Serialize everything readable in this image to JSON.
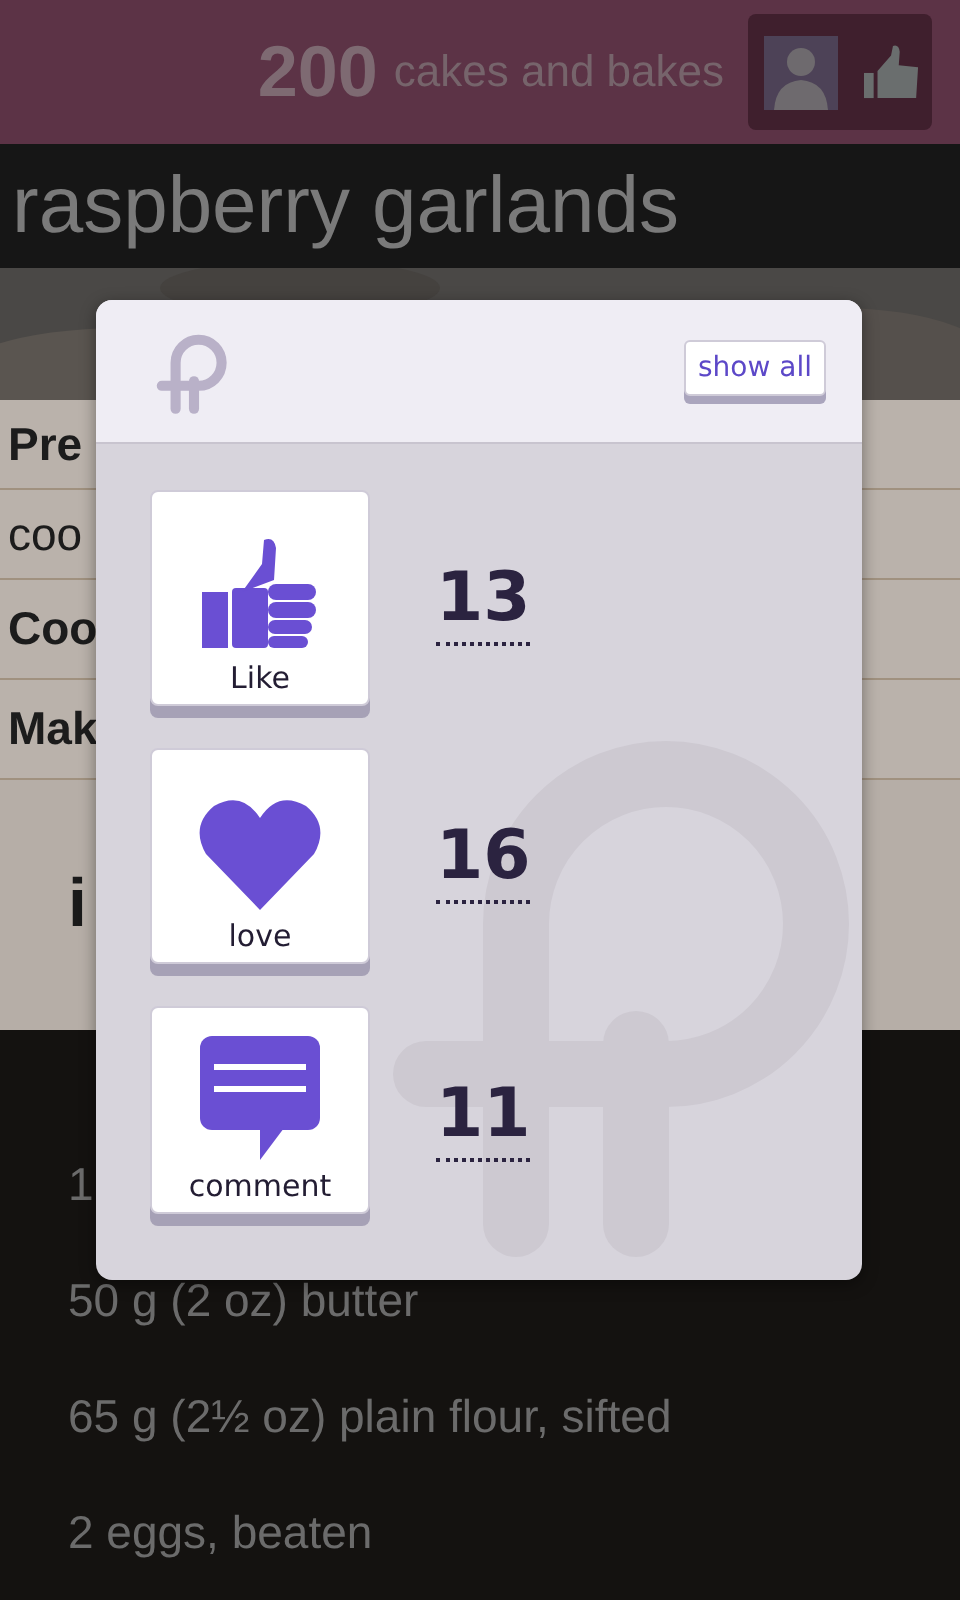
{
  "header": {
    "count": "200",
    "tagline": "cakes and bakes"
  },
  "title": "raspberry garlands",
  "details": [
    {
      "kind": "heading",
      "text": "Pre"
    },
    {
      "kind": "value",
      "text": "coo"
    },
    {
      "kind": "heading",
      "text": "Coo"
    },
    {
      "kind": "heading",
      "text": "Mak"
    }
  ],
  "section_heading": "i",
  "ingredients": [
    "1",
    "50 g (2 oz) butter",
    "65 g (2½ oz) plain flour, sifted",
    "2 eggs, beaten"
  ],
  "popup": {
    "button": "show all",
    "reactions": [
      {
        "kind": "like",
        "label": "Like",
        "count": "13"
      },
      {
        "kind": "love",
        "label": "love",
        "count": "16"
      },
      {
        "kind": "comment",
        "label": "comment",
        "count": "11"
      }
    ]
  }
}
